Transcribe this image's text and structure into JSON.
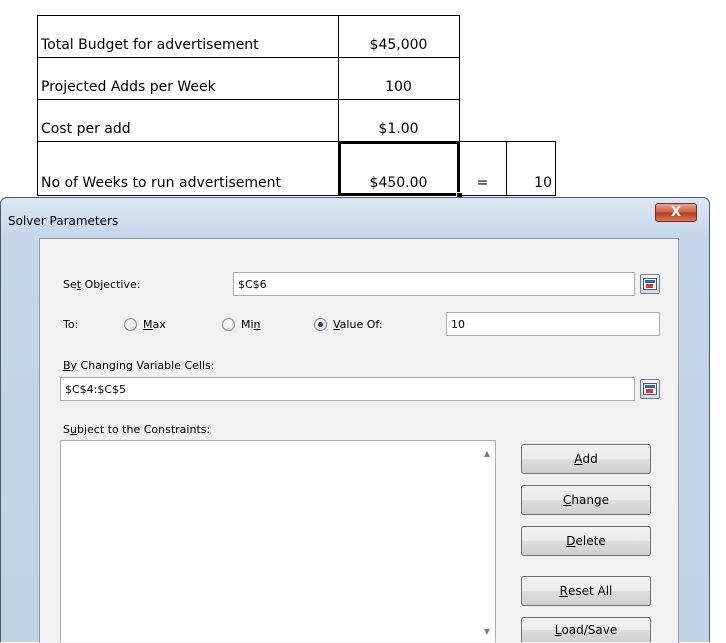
{
  "spreadsheet": {
    "rows": [
      {
        "label": "Total Budget for advertisement",
        "value": "$45,000"
      },
      {
        "label": "Projected Adds per Week",
        "value": "100"
      },
      {
        "label": "Cost per add",
        "value": "$1.00"
      },
      {
        "label": "No of Weeks to run advertisement",
        "value": "$450.00",
        "equals": "=",
        "result": "10"
      }
    ]
  },
  "dialog": {
    "title": "Solver Parameters",
    "close_glyph": "X",
    "set_objective": {
      "label_pre": "Se",
      "label_u": "t",
      "label_post": " Objective:",
      "value": "$C$6"
    },
    "to": {
      "label": "To:",
      "max": {
        "u": "M",
        "rest": "ax"
      },
      "min": {
        "pre": "Mi",
        "u": "n"
      },
      "value_of": {
        "u": "V",
        "rest": "alue Of:"
      },
      "value": "10"
    },
    "changing": {
      "label_u": "B",
      "label_rest": "y Changing Variable Cells:",
      "value": "$C$4:$C$5"
    },
    "constraints": {
      "label_pre": "S",
      "label_u": "u",
      "label_post": "bject to the Constraints:"
    },
    "buttons": {
      "add": {
        "u": "A",
        "rest": "dd"
      },
      "change": {
        "u": "C",
        "rest": "hange"
      },
      "delete": {
        "u": "D",
        "rest": "elete"
      },
      "reset": {
        "u": "R",
        "rest": "eset All"
      },
      "load": {
        "u": "L",
        "rest": "oad/Save"
      }
    },
    "scroll": {
      "up": "▲",
      "down": "▼"
    }
  },
  "colors": {
    "accent": "#1c3f80",
    "close": "#c74a30"
  }
}
